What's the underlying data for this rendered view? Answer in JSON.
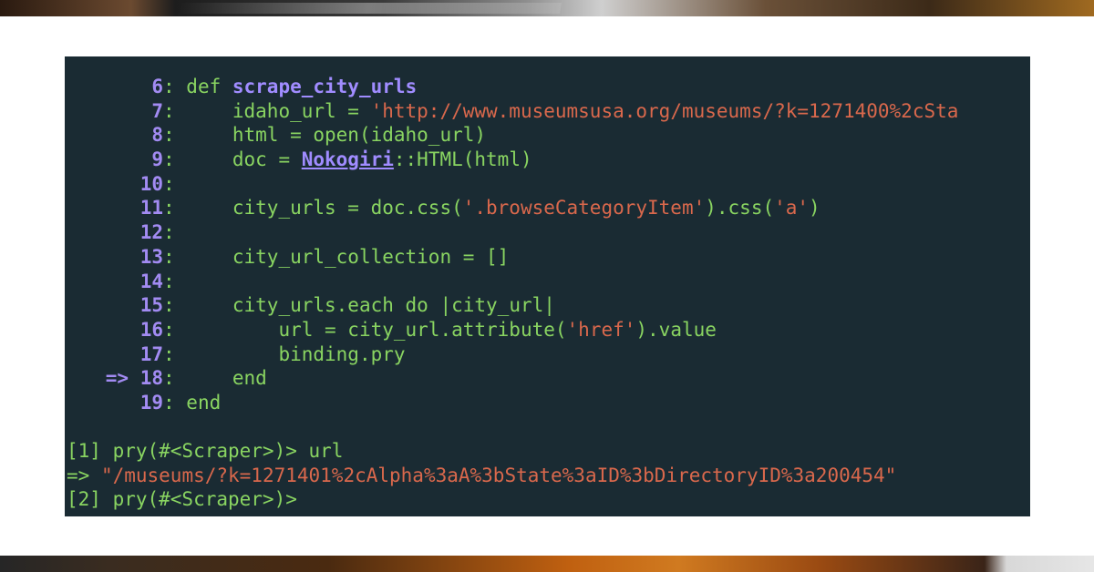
{
  "code_lines": [
    {
      "num": "6",
      "arrow": "",
      "parts": [
        {
          "t": "def ",
          "c": "kw"
        },
        {
          "t": "scrape_city_urls",
          "c": "fn"
        }
      ]
    },
    {
      "num": "7",
      "arrow": "",
      "parts": [
        {
          "t": "    idaho_url = ",
          "c": "plain"
        },
        {
          "t": "'http://www.museumsusa.org/museums/?k=1271400%2cSta",
          "c": "str"
        }
      ]
    },
    {
      "num": "8",
      "arrow": "",
      "parts": [
        {
          "t": "    html = open(idaho_url)",
          "c": "plain"
        }
      ]
    },
    {
      "num": "9",
      "arrow": "",
      "parts": [
        {
          "t": "    doc = ",
          "c": "plain"
        },
        {
          "t": "Nokogiri",
          "c": "const"
        },
        {
          "t": "::HTML(html)",
          "c": "plain"
        }
      ]
    },
    {
      "num": "10",
      "arrow": "",
      "parts": []
    },
    {
      "num": "11",
      "arrow": "",
      "parts": [
        {
          "t": "    city_urls = doc.css(",
          "c": "plain"
        },
        {
          "t": "'.browseCategoryItem'",
          "c": "str"
        },
        {
          "t": ").css(",
          "c": "plain"
        },
        {
          "t": "'a'",
          "c": "str"
        },
        {
          "t": ")",
          "c": "plain"
        }
      ]
    },
    {
      "num": "12",
      "arrow": "",
      "parts": []
    },
    {
      "num": "13",
      "arrow": "",
      "parts": [
        {
          "t": "    city_url_collection = []",
          "c": "plain"
        }
      ]
    },
    {
      "num": "14",
      "arrow": "",
      "parts": []
    },
    {
      "num": "15",
      "arrow": "",
      "parts": [
        {
          "t": "    city_urls.each ",
          "c": "plain"
        },
        {
          "t": "do",
          "c": "kw"
        },
        {
          "t": " |city_url|",
          "c": "plain"
        }
      ]
    },
    {
      "num": "16",
      "arrow": "",
      "parts": [
        {
          "t": "        url = city_url.attribute(",
          "c": "plain"
        },
        {
          "t": "'href'",
          "c": "str"
        },
        {
          "t": ").value",
          "c": "plain"
        }
      ]
    },
    {
      "num": "17",
      "arrow": "",
      "parts": [
        {
          "t": "        binding.pry",
          "c": "plain"
        }
      ]
    },
    {
      "num": "18",
      "arrow": "=> ",
      "parts": [
        {
          "t": "    end",
          "c": "kw"
        }
      ]
    },
    {
      "num": "19",
      "arrow": "",
      "parts": [
        {
          "t": "end",
          "c": "kw"
        }
      ]
    }
  ],
  "repl_lines": [
    [
      {
        "t": "[1] pry(#<Scraper>)> url",
        "c": "plain"
      }
    ],
    [
      {
        "t": "=> ",
        "c": "plain"
      },
      {
        "t": "\"/museums/?k=1271401%2cAlpha%3aA%3bState%3aID%3bDirectoryID%3a200454\"",
        "c": "str"
      }
    ],
    [
      {
        "t": "[2] pry(#<Scraper>)>",
        "c": "plain"
      }
    ]
  ]
}
